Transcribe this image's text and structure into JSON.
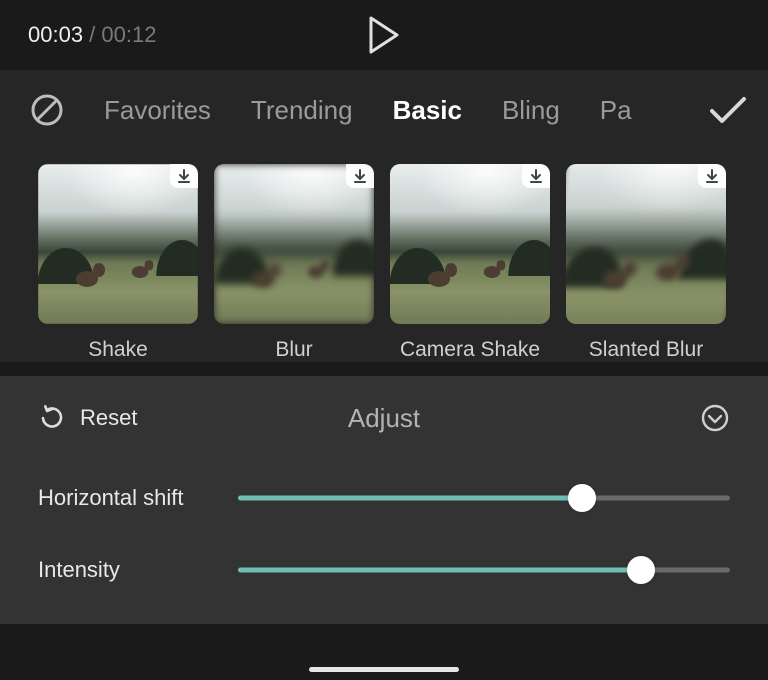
{
  "player": {
    "current_time": "00:03",
    "separator": " / ",
    "duration": "00:12"
  },
  "categories": {
    "items": [
      "Favorites",
      "Trending",
      "Basic",
      "Bling",
      "Pa"
    ],
    "active_index": 2
  },
  "effects": [
    {
      "label": "Shake",
      "downloadable": true
    },
    {
      "label": "Blur",
      "downloadable": true
    },
    {
      "label": "Camera Shake",
      "downloadable": true
    },
    {
      "label": "Slanted Blur",
      "downloadable": true
    }
  ],
  "adjust": {
    "reset_label": "Reset",
    "title": "Adjust",
    "sliders": [
      {
        "label": "Horizontal shift",
        "value": 70
      },
      {
        "label": "Intensity",
        "value": 82
      }
    ]
  },
  "colors": {
    "accent": "#6fbdb3",
    "panel": "#333333",
    "tabs_bg": "#262626"
  }
}
